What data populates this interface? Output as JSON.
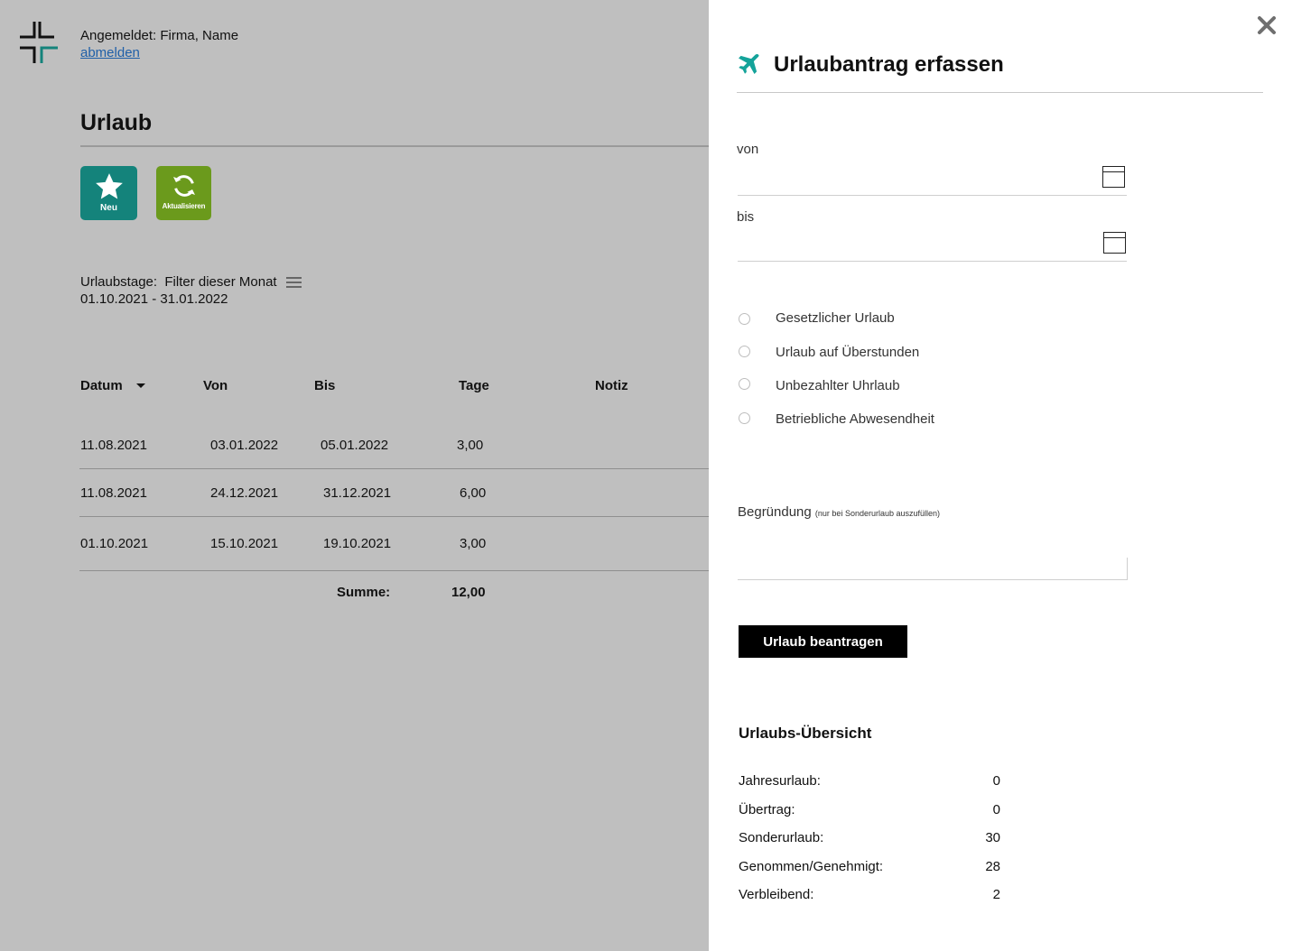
{
  "header": {
    "login_text": "Angemeldet: Firma, Name",
    "logout_link": "abmelden"
  },
  "page": {
    "title": "Urlaub",
    "tiles": {
      "new_label": "Neu",
      "refresh_label": "Aktualisieren",
      "new_color": "#14837b",
      "refresh_color": "#6b9a1c"
    },
    "filter": {
      "line1": "Urlaubstage:  Filter dieser Monat",
      "line2": "01.10.2021 - 31.01.2022"
    },
    "table": {
      "columns": [
        "Datum",
        "Von",
        "Bis",
        "Tage",
        "Notiz"
      ],
      "rows": [
        {
          "datum": "11.08.2021",
          "von": "03.01.2022",
          "bis": "05.01.2022",
          "tage": "3,00",
          "notiz": ""
        },
        {
          "datum": "11.08.2021",
          "von": "24.12.2021",
          "bis": "31.12.2021",
          "tage": "6,00",
          "notiz": ""
        },
        {
          "datum": "01.10.2021",
          "von": "15.10.2021",
          "bis": "19.10.2021",
          "tage": "3,00",
          "notiz": ""
        }
      ],
      "sum_label": "Summe:",
      "sum_value": "12,00"
    }
  },
  "drawer": {
    "title": "Urlaubantrag erfassen",
    "icon": "airplane-icon",
    "accent_color": "#14a39a",
    "from_label": "von",
    "to_label": "bis",
    "from_value": "",
    "to_value": "",
    "leave_types": [
      "Gesetzlicher Urlaub",
      "Urlaub auf Überstunden",
      "Unbezahlter Uhrlaub",
      "Betriebliche Abwesendheit"
    ],
    "reason_label": "Begründung",
    "reason_hint": "(nur bei Sonderurlaub auszufüllen)",
    "reason_value": "",
    "submit_label": "Urlaub beantragen",
    "overview": {
      "title": "Urlaubs-Übersicht",
      "items": [
        {
          "label": "Jahresurlaub:",
          "value": "0"
        },
        {
          "label": "Übertrag:",
          "value": "0"
        },
        {
          "label": "Sonderurlaub:",
          "value": "30"
        },
        {
          "label": "Genommen/Genehmigt:",
          "value": "28"
        },
        {
          "label": "Verbleibend:",
          "value": "2"
        }
      ]
    }
  }
}
